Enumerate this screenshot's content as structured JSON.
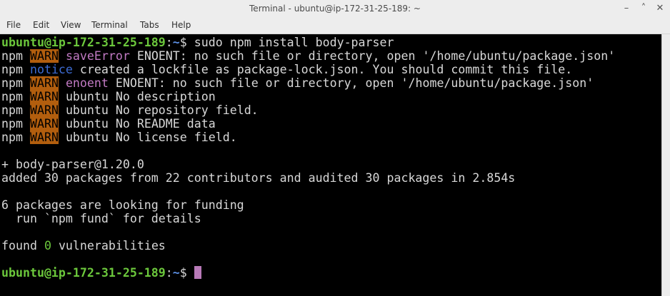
{
  "window": {
    "title": "Terminal - ubuntu@ip-172-31-25-189: ~",
    "minimize_glyph": "–",
    "maximize_glyph": "˄",
    "close_glyph": "✕"
  },
  "menu": {
    "file": "File",
    "edit": "Edit",
    "view": "View",
    "terminal": "Terminal",
    "tabs": "Tabs",
    "help": "Help"
  },
  "terminal": {
    "prompt_user": "ubuntu@ip-172-31-25-189",
    "prompt_sep": ":",
    "prompt_path": "~",
    "prompt_symbol": "$",
    "command": " sudo npm install body-parser",
    "npm": "npm ",
    "warn": "WARN",
    "notice": "notice",
    "l2_tag": "saveError",
    "l2_text": " ENOENT: no such file or directory, open '/home/ubuntu/package.json'",
    "l3_text": " created a lockfile as package-lock.json. You should commit this file.",
    "l4_tag": "enoent",
    "l4_text": " ENOENT: no such file or directory, open '/home/ubuntu/package.json'",
    "l5_text": "ubuntu No description",
    "l6_text": "ubuntu No repository field.",
    "l7_text": "ubuntu No README data",
    "l8_text": "ubuntu No license field.",
    "installed": "+ body-parser@1.20.0",
    "added": "added 30 packages from 22 contributors and audited 30 packages in 2.854s",
    "funding": "6 packages are looking for funding",
    "fund_hint": "  run `npm fund` for details",
    "found_a": "found ",
    "found_count": "0",
    "found_b": " vulnerabilities"
  },
  "colors": {
    "background": "#000000",
    "prompt_user": "#6cc83c",
    "prompt_path": "#5b8ee2",
    "warn_bg": "#b25e0e",
    "tag": "#c27ac4",
    "notice": "#3d6cd4",
    "cursor": "#b87ab8"
  }
}
